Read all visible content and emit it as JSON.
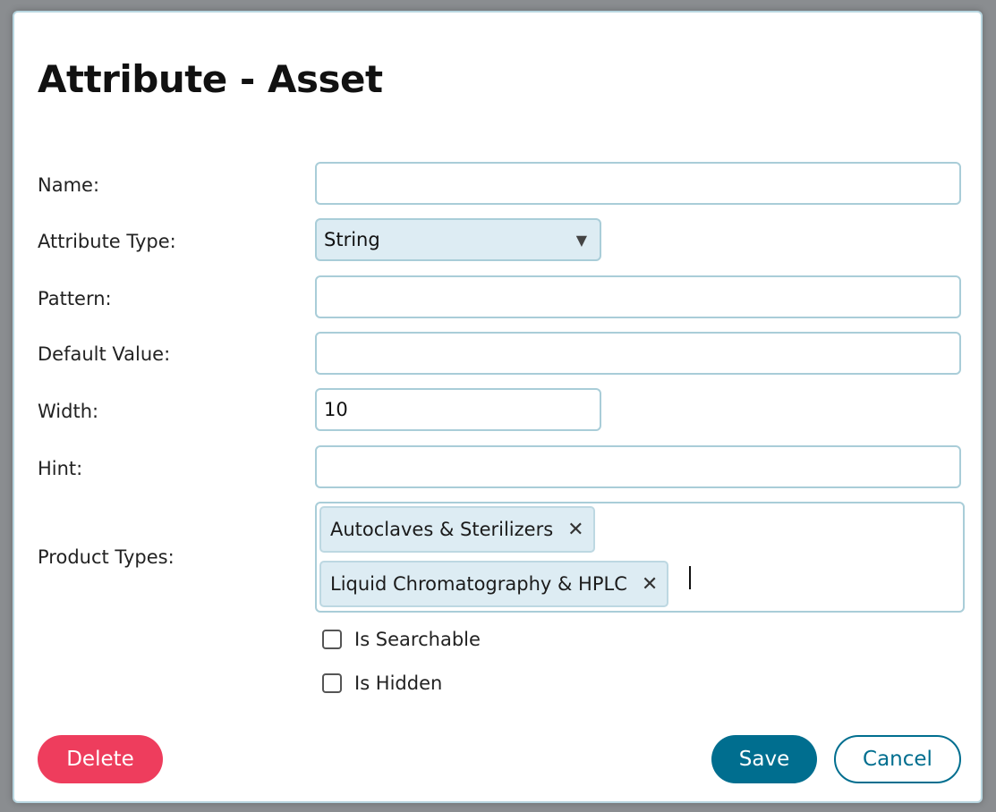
{
  "dialog": {
    "title": "Attribute - Asset"
  },
  "fields": {
    "name": {
      "label": "Name:",
      "value": ""
    },
    "attribute_type": {
      "label": "Attribute Type:",
      "value": "String"
    },
    "pattern": {
      "label": "Pattern:",
      "value": ""
    },
    "default_value": {
      "label": "Default Value:",
      "value": ""
    },
    "width": {
      "label": "Width:",
      "value": "10"
    },
    "hint": {
      "label": "Hint:",
      "value": ""
    },
    "product_types": {
      "label": "Product Types:",
      "chips": [
        "Autoclaves & Sterilizers",
        "Liquid Chromatography & HPLC"
      ]
    }
  },
  "checkboxes": {
    "searchable": {
      "label": "Is Searchable",
      "checked": false
    },
    "hidden": {
      "label": "Is Hidden",
      "checked": false
    }
  },
  "buttons": {
    "delete": "Delete",
    "save": "Save",
    "cancel": "Cancel"
  },
  "icons": {
    "dropdown": "▼",
    "remove": "✕"
  },
  "colors": {
    "delete": "#ee3d5d",
    "primary": "#006e8f",
    "field_border": "#a9cdd8",
    "chip_bg": "#ddecf3"
  }
}
